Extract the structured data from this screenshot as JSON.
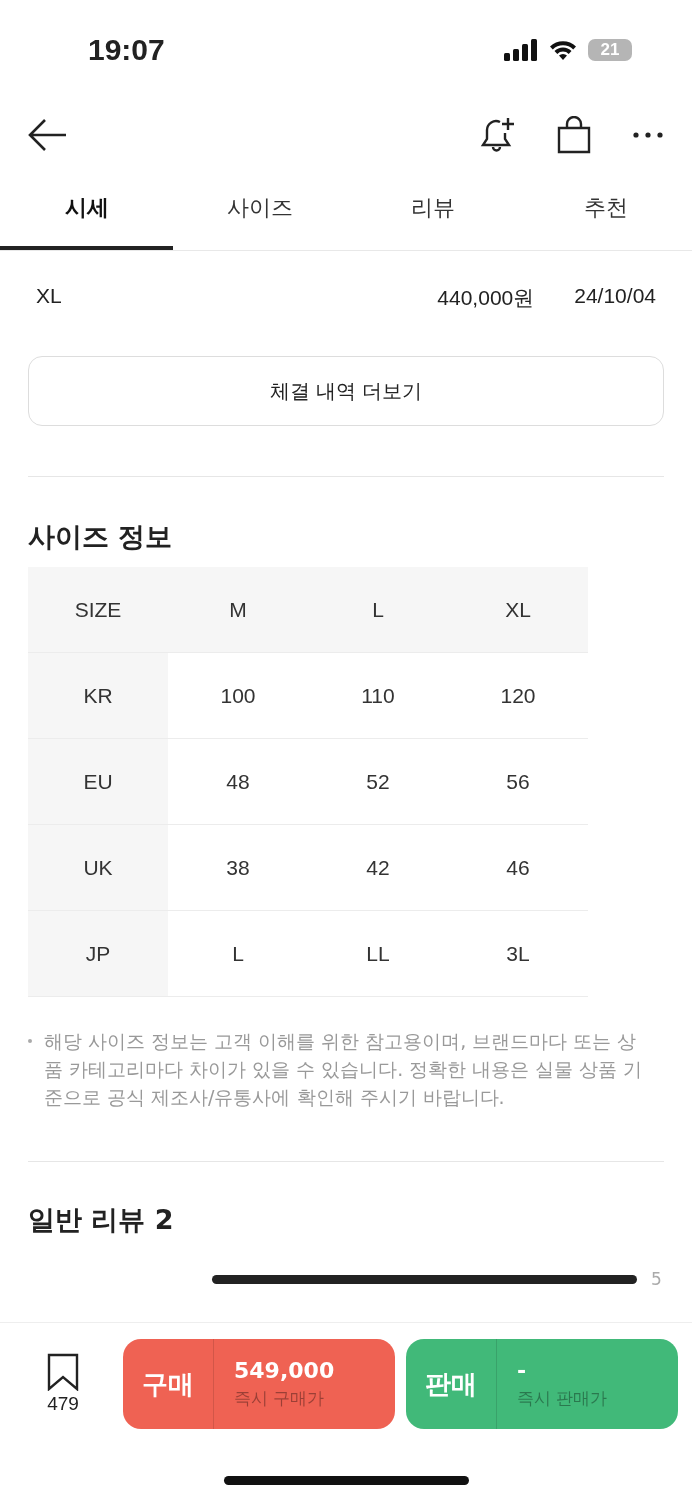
{
  "status_bar": {
    "time": "19:07",
    "battery": "21"
  },
  "tabs": [
    {
      "label": "시세",
      "selected": true
    },
    {
      "label": "사이즈",
      "selected": false
    },
    {
      "label": "리뷰",
      "selected": false
    },
    {
      "label": "추천",
      "selected": false
    }
  ],
  "trades": [
    {
      "size": "XL",
      "price": "440,000원",
      "date": "24/10/04"
    }
  ],
  "more_button": "체결 내역 더보기",
  "size_info": {
    "title": "사이즈 정보",
    "columns": [
      "SIZE",
      "M",
      "L",
      "XL"
    ],
    "rows": [
      [
        "KR",
        "100",
        "110",
        "120"
      ],
      [
        "EU",
        "48",
        "52",
        "56"
      ],
      [
        "UK",
        "38",
        "42",
        "46"
      ],
      [
        "JP",
        "L",
        "LL",
        "3L"
      ]
    ],
    "note": "해당 사이즈 정보는 고객 이해를 위한 참고용이며, 브랜드마다 또는 상품 카테고리마다 차이가 있을 수 있습니다. 정확한 내용은 실물 상품 기준으로 공식 제조사/유통사에 확인해 주시기 바랍니다."
  },
  "reviews": {
    "title": "일반 리뷰 2",
    "page": "5"
  },
  "bottom_bar": {
    "wish_count": "479",
    "buy": {
      "label": "구매",
      "price": "549,000",
      "caption": "즉시 구매가"
    },
    "sell": {
      "label": "판매",
      "price": "-",
      "caption": "즉시 판매가"
    }
  }
}
